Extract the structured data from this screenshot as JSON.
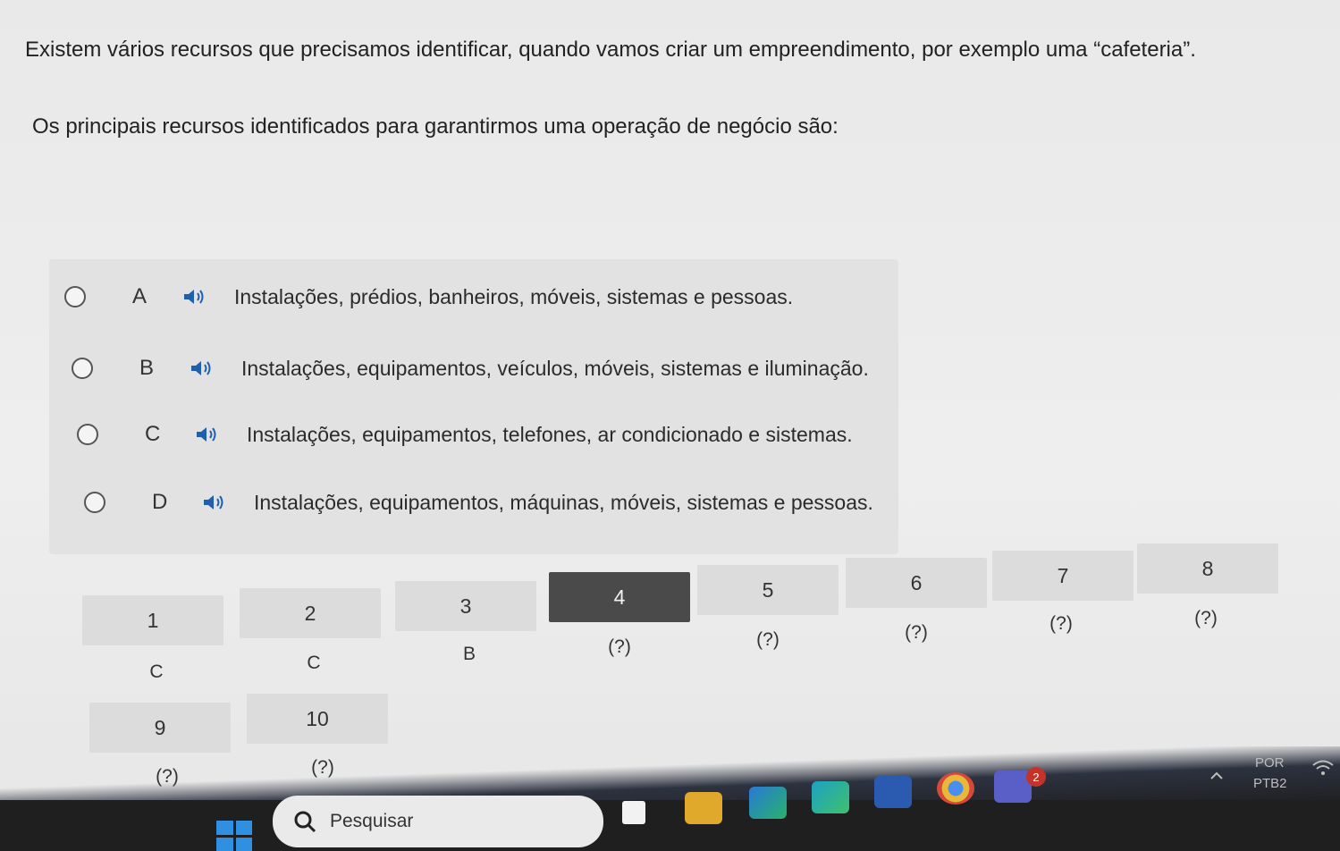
{
  "question": {
    "line1": "Existem vários recursos que precisamos identificar, quando vamos criar um empreendimento, por exemplo uma “cafeteria”.",
    "line2": "Os principais recursos identificados para garantirmos uma operação de negócio são:"
  },
  "options": [
    {
      "letter": "A",
      "text": "Instalações, prédios, banheiros, móveis, sistemas e pessoas."
    },
    {
      "letter": "B",
      "text": "Instalações, equipamentos, veículos, móveis, sistemas e iluminação."
    },
    {
      "letter": "C",
      "text": "Instalações, equipamentos, telefones, ar condicionado e sistemas."
    },
    {
      "letter": "D",
      "text": "Instalações, equipamentos, máquinas, móveis, sistemas e pessoas."
    }
  ],
  "navigator": [
    {
      "number": "1",
      "status": "C"
    },
    {
      "number": "2",
      "status": "C"
    },
    {
      "number": "3",
      "status": "B"
    },
    {
      "number": "4",
      "status": "(?)"
    },
    {
      "number": "5",
      "status": "(?)"
    },
    {
      "number": "6",
      "status": "(?)"
    },
    {
      "number": "7",
      "status": "(?)"
    },
    {
      "number": "8",
      "status": "(?)"
    },
    {
      "number": "9",
      "status": "(?)"
    },
    {
      "number": "10",
      "status": "(?)"
    }
  ],
  "taskbar": {
    "search_placeholder": "Pesquisar",
    "lang_top": "POR",
    "lang_bottom": "PTB2",
    "teams_badge": "2"
  },
  "colors": {
    "active_question": "#4a4a4a",
    "accent": "#2f8fe0"
  }
}
